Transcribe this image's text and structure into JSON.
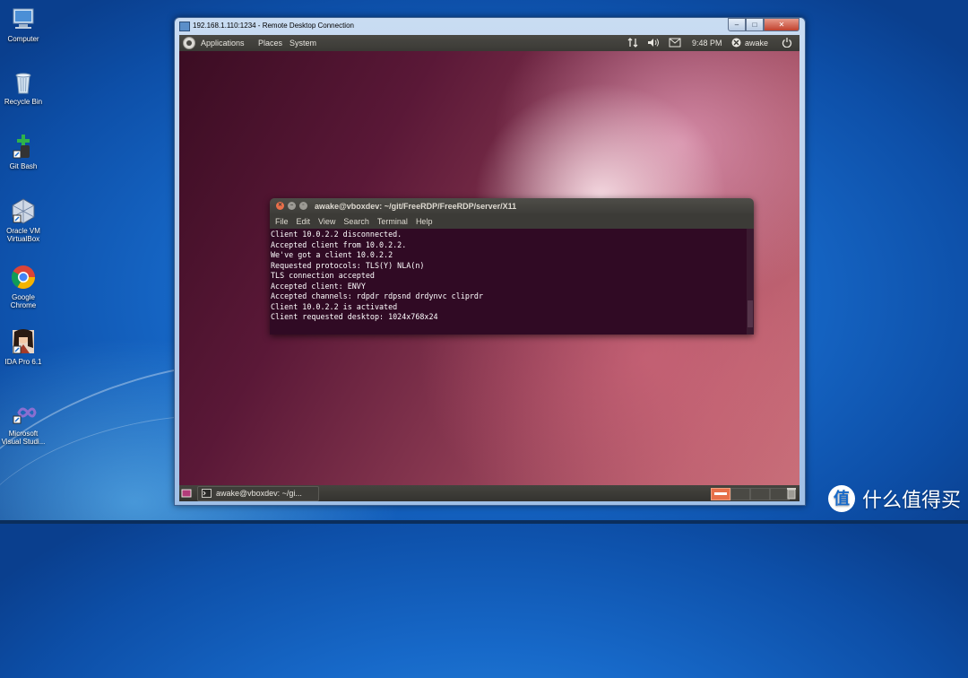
{
  "desktop": {
    "icons": [
      {
        "label": "Computer",
        "icon": "computer-icon"
      },
      {
        "label": "Recycle Bin",
        "icon": "recycle-bin-icon"
      },
      {
        "label": "Git Bash",
        "icon": "git-bash-icon"
      },
      {
        "label": "Oracle VM VirtualBox",
        "icon": "virtualbox-icon"
      },
      {
        "label": "Google Chrome",
        "icon": "chrome-icon"
      },
      {
        "label": "IDA Pro 6.1",
        "icon": "ida-pro-icon"
      },
      {
        "label": "Microsoft Visual Studi...",
        "icon": "visual-studio-icon"
      }
    ]
  },
  "rdp_window": {
    "title": "192.168.1.110:1234 - Remote Desktop Connection",
    "buttons": {
      "minimize": "–",
      "maximize": "□",
      "close": "✕"
    }
  },
  "ubuntu": {
    "top_panel": {
      "menus": [
        "Applications",
        "Places",
        "System"
      ],
      "clock": "9:48 PM",
      "user": "awake"
    },
    "bottom_panel": {
      "task_label": "awake@vboxdev: ~/gi..."
    }
  },
  "terminal": {
    "title": "awake@vboxdev: ~/git/FreeRDP/FreeRDP/server/X11",
    "menu": [
      "File",
      "Edit",
      "View",
      "Search",
      "Terminal",
      "Help"
    ],
    "lines": [
      "Client 10.0.2.2 disconnected.",
      "Accepted client from 10.0.2.2.",
      "We've got a client 10.0.2.2",
      "Requested protocols: TLS(Y) NLA(n)",
      "TLS connection accepted",
      "Accepted client: ENVY",
      "Accepted channels: rdpdr rdpsnd drdynvc cliprdr",
      "Client 10.0.2.2 is activated",
      "Client requested desktop: 1024x768x24"
    ]
  },
  "watermark": {
    "logo_char": "值",
    "text": "什么值得买"
  }
}
